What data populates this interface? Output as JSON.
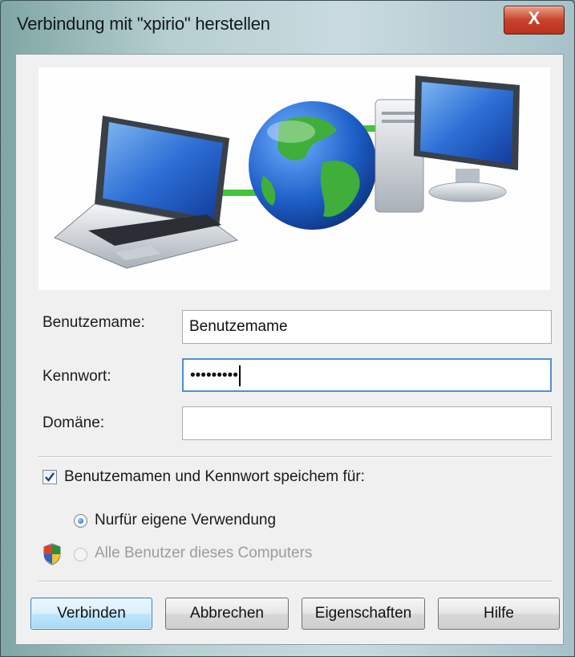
{
  "window": {
    "title": "Verbindung mit \"xpirio\" herstellen",
    "close_glyph": "X"
  },
  "form": {
    "username_label": "Benutzemame:",
    "username_value": "Benutzemame",
    "password_label": "Kennwort:",
    "password_value": "•••••••••",
    "domain_label": "Domäne:",
    "domain_value": ""
  },
  "save": {
    "label": "Benutzemamen und Kennwort speichem für:",
    "checked": true,
    "options": [
      {
        "label": "Nurfür eigene Verwendung",
        "selected": true,
        "enabled": true
      },
      {
        "label": "Alle Benutzer dieses Computers",
        "selected": false,
        "enabled": false
      }
    ]
  },
  "buttons": {
    "connect": "Verbinden",
    "cancel": "Abbrechen",
    "properties": "Eigenschaften",
    "help": "Hilfe"
  },
  "icons": {
    "banner": [
      "laptop-icon",
      "globe-icon",
      "desktop-computer-icon"
    ],
    "uac": "uac-shield-icon",
    "check": "checkmark-icon"
  },
  "colors": {
    "close": "#c8432b",
    "default_button": "#3c7fb1",
    "focus": "#4f8fd6"
  }
}
